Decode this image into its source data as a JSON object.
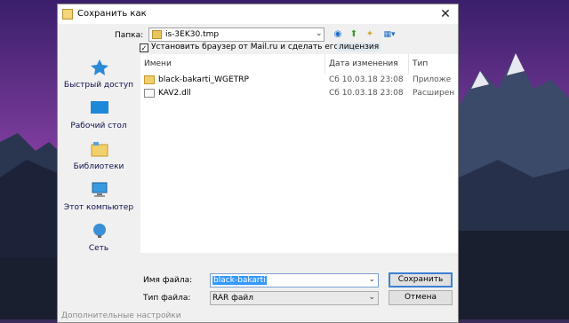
{
  "dialog": {
    "title": "Сохранить как",
    "close_label": "✕"
  },
  "address": {
    "label": "Папка:",
    "value": "is-3EK30.tmp",
    "arrow": "⌄"
  },
  "toolbar": {
    "back_icon": "◉",
    "up_icon": "⬆",
    "new_folder_icon": "✦",
    "view_icon": "▦▾"
  },
  "option": {
    "checked_mark": "✓",
    "text": "Установить браузер от Mail.ru и сделать его основны",
    "link": "лицензия"
  },
  "sidebar": {
    "items": [
      {
        "label": "Быстрый доступ",
        "icon": "star-icon"
      },
      {
        "label": "Рабочий стол",
        "icon": "desktop-icon"
      },
      {
        "label": "Библиотеки",
        "icon": "library-icon"
      },
      {
        "label": "Этот компьютер",
        "icon": "computer-icon"
      },
      {
        "label": "Сеть",
        "icon": "network-icon"
      }
    ]
  },
  "file_list": {
    "columns": [
      "Имени",
      "Дата изменения",
      "Тип"
    ],
    "rows": [
      {
        "name": "black-bakarti_WGETRP",
        "date": "Сб 10.03.18 23:08",
        "type": "Приложе",
        "icon": "folder-icon"
      },
      {
        "name": "KAV2.dll",
        "date": "Сб 10.03.18 23:08",
        "type": "Расширен",
        "icon": "dll-file-icon"
      }
    ]
  },
  "form": {
    "filename_label": "Имя файла:",
    "filename_value": "black-bakarti",
    "filetype_label": "Тип файла:",
    "filetype_value": "RAR файл",
    "dropdown_arrow": "⌄",
    "save_label": "Сохранить",
    "cancel_label": "Отмена"
  },
  "footer": {
    "more_settings": "Дополнительные настройки"
  },
  "colors": {
    "accent": "#3399ff",
    "sky_top": "#3a1f6b",
    "sky_bottom": "#e0489e"
  }
}
